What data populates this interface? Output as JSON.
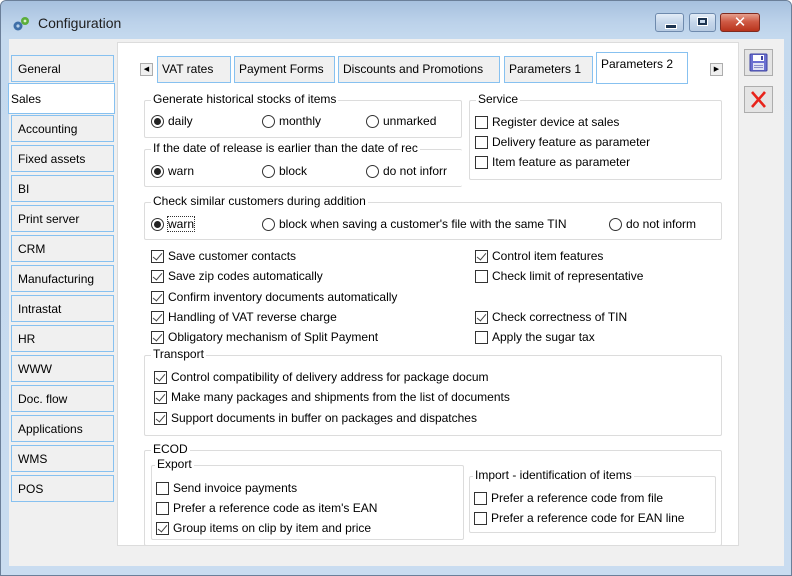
{
  "window": {
    "title": "Configuration",
    "icon": "gears-icon",
    "controls": {
      "minimize": "minimize-icon",
      "maximize": "maximize-icon",
      "close": "close-icon",
      "close_glyph": "✕"
    }
  },
  "sidebar": {
    "active": "Sales",
    "items": [
      {
        "label": "General"
      },
      {
        "label": "Sales"
      },
      {
        "label": "Accounting"
      },
      {
        "label": "Fixed assets"
      },
      {
        "label": "BI"
      },
      {
        "label": "Print server"
      },
      {
        "label": "CRM"
      },
      {
        "label": "Manufacturing"
      },
      {
        "label": "Intrastat"
      },
      {
        "label": "HR"
      },
      {
        "label": "WWW"
      },
      {
        "label": "Doc. flow"
      },
      {
        "label": "Applications"
      },
      {
        "label": "WMS"
      },
      {
        "label": "POS"
      }
    ]
  },
  "tabs": {
    "scroll_left": "◀",
    "scroll_right": "▶",
    "active": "Parameters 2",
    "items": [
      {
        "label": "VAT rates"
      },
      {
        "label": "Payment Forms"
      },
      {
        "label": "Discounts and Promotions"
      },
      {
        "label": "Parameters 1"
      },
      {
        "label": "Parameters 2"
      }
    ]
  },
  "actions": {
    "save": "save-icon",
    "cancel": "cancel-icon",
    "cancel_glyph": "✕"
  },
  "historical_stocks": {
    "title": "Generate historical stocks of items",
    "options": [
      {
        "label": "daily",
        "checked": true
      },
      {
        "label": "monthly",
        "checked": false
      },
      {
        "label": "unmarked",
        "checked": false
      }
    ]
  },
  "release_date": {
    "title": "If the date of release is earlier than the date of rec",
    "options": [
      {
        "label": "warn",
        "checked": true
      },
      {
        "label": "block",
        "checked": false
      },
      {
        "label": "do not inforr",
        "checked": false
      }
    ]
  },
  "service": {
    "title": "Service",
    "items": [
      {
        "label": "Register device at sales",
        "checked": false
      },
      {
        "label": "Delivery feature as parameter",
        "checked": false
      },
      {
        "label": "Item feature as parameter",
        "checked": false
      }
    ]
  },
  "similar_customers": {
    "title": "Check similar customers during addition",
    "options": [
      {
        "label": "warn",
        "checked": true
      },
      {
        "label": "block when saving a customer's file with the same TIN",
        "checked": false
      },
      {
        "label": "do not inform",
        "checked": false
      }
    ]
  },
  "options_left": [
    {
      "label": "Save customer contacts",
      "checked": true
    },
    {
      "label": "Save zip codes automatically",
      "checked": true
    },
    {
      "label": "Confirm inventory documents automatically",
      "checked": true
    },
    {
      "label": "Handling of VAT reverse charge",
      "checked": true
    },
    {
      "label": "Obligatory mechanism of Split Payment",
      "checked": true
    }
  ],
  "options_right": [
    {
      "label": "Control item features",
      "checked": true
    },
    {
      "label": "Check limit of representative",
      "checked": false
    },
    {
      "label": "Check correctness of TIN",
      "checked": true
    },
    {
      "label": "Apply the sugar tax",
      "checked": false
    }
  ],
  "transport": {
    "title": "Transport",
    "items": [
      {
        "label": "Control compatibility of delivery address for package docum",
        "checked": true
      },
      {
        "label": "Make many packages and shipments from the list of documents",
        "checked": true
      },
      {
        "label": "Support documents in buffer on packages and dispatches",
        "checked": true
      }
    ]
  },
  "ecod": {
    "title": "ECOD",
    "export": {
      "title": "Export",
      "items": [
        {
          "label": "Send invoice payments",
          "checked": false
        },
        {
          "label": "Prefer a reference code as item's EAN",
          "checked": false
        },
        {
          "label": "Group items on clip by item and price",
          "checked": true
        }
      ]
    },
    "import": {
      "title": "Import - identification of items",
      "items": [
        {
          "label": "Prefer a reference code from file",
          "checked": false
        },
        {
          "label": "Prefer a reference code for EAN line",
          "checked": false
        }
      ]
    }
  }
}
